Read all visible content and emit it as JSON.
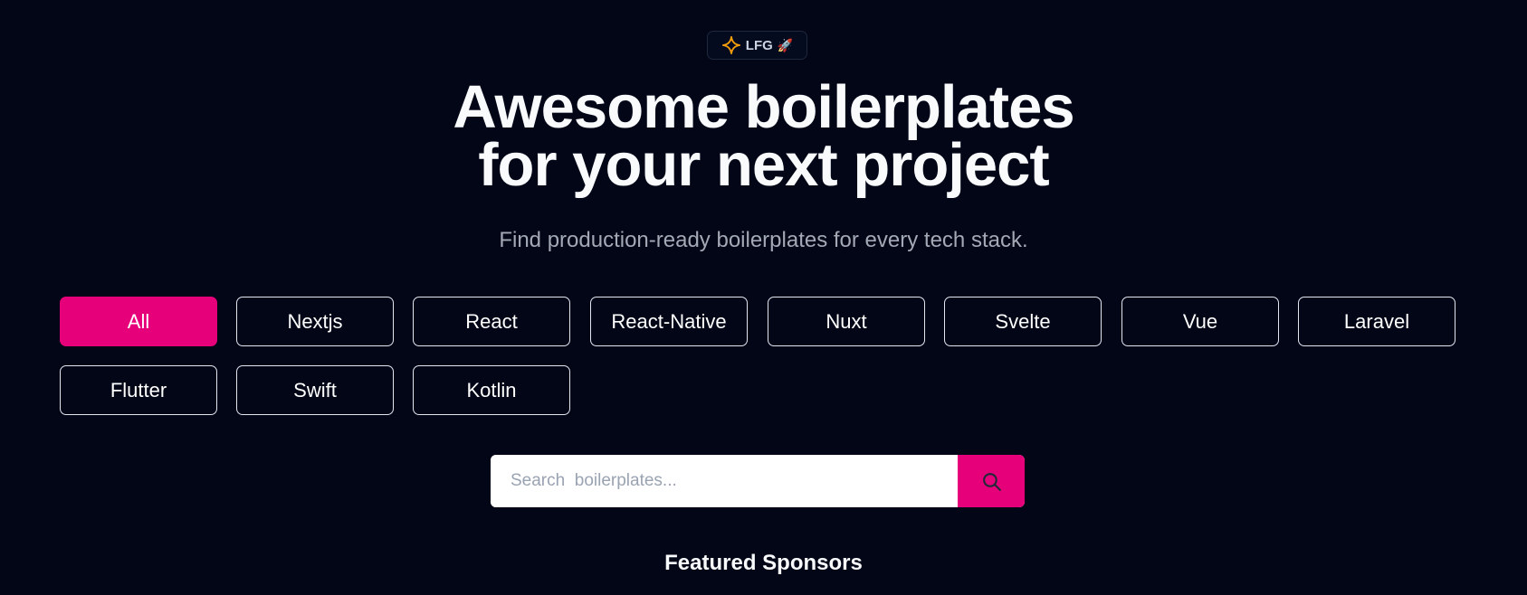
{
  "badge": {
    "label": "LFG",
    "emoji": "🚀",
    "sparkle_color": "#f59e0b"
  },
  "hero": {
    "title_line_1": "Awesome boilerplates",
    "title_line_2": "for your next project",
    "subtitle": "Find production-ready boilerplates for every tech stack."
  },
  "filters": {
    "active": "All",
    "items": [
      {
        "label": "All"
      },
      {
        "label": "Nextjs"
      },
      {
        "label": "React"
      },
      {
        "label": "React-Native"
      },
      {
        "label": "Nuxt"
      },
      {
        "label": "Svelte"
      },
      {
        "label": "Vue"
      },
      {
        "label": "Laravel"
      },
      {
        "label": "Flutter"
      },
      {
        "label": "Swift"
      },
      {
        "label": "Kotlin"
      }
    ]
  },
  "search": {
    "placeholder": "Search  boilerplates...",
    "value": "",
    "button_icon": "search-icon"
  },
  "featured": {
    "title": "Featured Sponsors"
  },
  "colors": {
    "background": "#020617",
    "accent": "#e6007a",
    "text": "#f8fafc",
    "muted_text": "#a3a9b5"
  }
}
